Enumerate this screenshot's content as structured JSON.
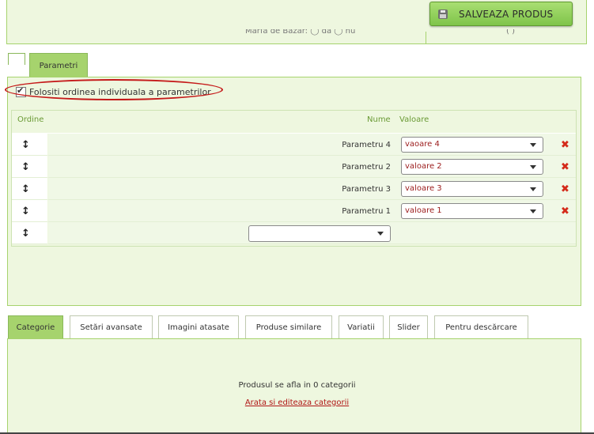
{
  "header": {
    "save_label": "SALVEAZA PRODUS",
    "cutoff_text": "Marfa de Bazar:  ◯ da  ◯ nu",
    "cutoff_right": "(          )"
  },
  "tabs_top": {
    "parametri": "Parametri"
  },
  "params": {
    "checkbox_label": "Folositi ordinea individuala a parametrilor",
    "checkbox_checked": true,
    "columns": {
      "ordine": "Ordine",
      "nume": "Nume",
      "valoare": "Valoare"
    },
    "rows": [
      {
        "name": "Parametru 4",
        "value": "vaoare 4"
      },
      {
        "name": "Parametru 2",
        "value": "valoare 2"
      },
      {
        "name": "Parametru 3",
        "value": "valoare 3"
      },
      {
        "name": "Parametru 1",
        "value": "valoare 1"
      }
    ],
    "drag_glyph": "↕",
    "delete_glyph": "✖"
  },
  "bottom_tabs": [
    {
      "label": "Categorie",
      "active": true
    },
    {
      "label": "Setări avansate",
      "active": false
    },
    {
      "label": "Imagini atasate",
      "active": false
    },
    {
      "label": "Produse similare",
      "active": false
    },
    {
      "label": "Variatii",
      "active": false
    },
    {
      "label": "Slider",
      "active": false
    },
    {
      "label": "Pentru descărcare",
      "active": false
    }
  ],
  "category": {
    "status_text": "Produsul se afla in 0 categorii",
    "edit_link": "Arata si editeaza categorii"
  },
  "colors": {
    "accent": "#a6d36d",
    "panel_bg": "#eef7df",
    "value_text": "#9b1b1b",
    "delete": "#d42a1a",
    "highlight_oval": "#c51a1a"
  }
}
